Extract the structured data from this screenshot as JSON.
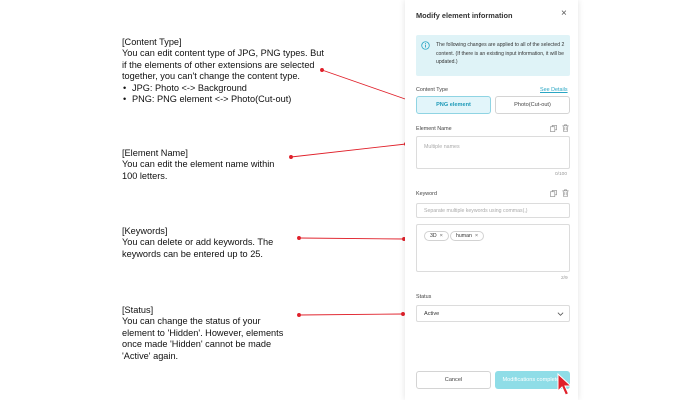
{
  "annotations": {
    "content_type": {
      "title": "[Content Type]",
      "body": "You can edit content type of JPG, PNG types. But if the elements of other extensions are selected together, you can't change the content type.",
      "bullets": [
        "JPG: Photo <-> Background",
        "PNG: PNG element <-> Photo(Cut-out)"
      ]
    },
    "element_name": {
      "title": "[Element Name]",
      "body": "You can edit the element name within 100 letters."
    },
    "keywords": {
      "title": "[Keywords]",
      "body": "You can delete or add keywords. The keywords can be entered  up to 25."
    },
    "status": {
      "title": "[Status]",
      "body": "You can change the status of your element to 'Hidden'. However, elements once made 'Hidden' cannot be made 'Active' again."
    },
    "arrow_color": "#e0202a"
  },
  "modal": {
    "title": "Modify element information",
    "close_glyph": "×",
    "info_text": "The following changes are applied to all of the selected 2 content. (If there is an existing input information, it will be updated.)",
    "content_type": {
      "label": "Content Type",
      "see_details": "See Details",
      "options": [
        "PNG element",
        "Photo(Cut-out)"
      ],
      "selected": "PNG element"
    },
    "element_name": {
      "label": "Element Name",
      "placeholder": "Multiple names",
      "counter": "0/100"
    },
    "keyword": {
      "label": "Keyword",
      "placeholder": "Separate multiple keywords using commas(,)",
      "chips": [
        "3D",
        "human"
      ],
      "chip_remove_glyph": "×",
      "counter": "2/9"
    },
    "status": {
      "label": "Status",
      "value": "Active"
    },
    "buttons": {
      "cancel": "Cancel",
      "submit": "Modifications completed"
    },
    "icons": {
      "info": "info-circle-icon",
      "copy": "copy-icon",
      "delete": "trash-icon",
      "dropdown": "chevron-down-icon",
      "cursor": "mouse-pointer-icon"
    },
    "colors": {
      "accent": "#2aa6c4",
      "info_bg": "#dff3f7",
      "submit_bg": "#8fdde7",
      "cursor": "#e0202a"
    }
  }
}
